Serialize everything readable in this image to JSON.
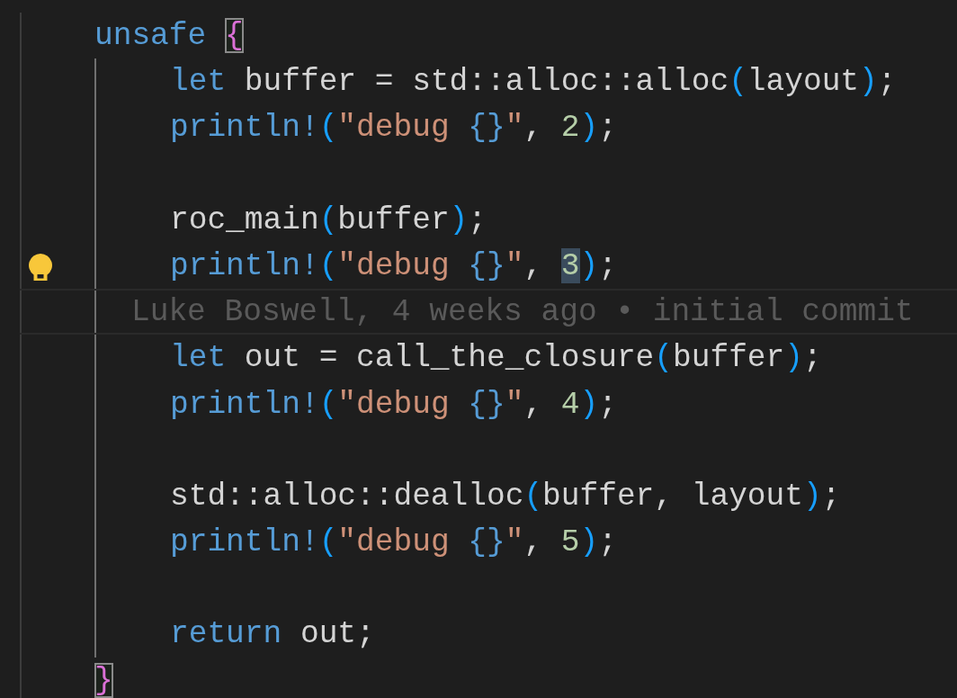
{
  "lines": [
    {
      "kind": "code",
      "tokens": [
        {
          "text": "unsafe ",
          "kind": "keyword"
        },
        {
          "text": "{",
          "kind": "brace",
          "matched": true
        }
      ],
      "children": [
        {
          "kind": "code",
          "tokens": [
            {
              "text": "let ",
              "kind": "keyword"
            },
            {
              "text": "buffer = std::alloc::alloc",
              "kind": "plain"
            },
            {
              "text": "(",
              "kind": "paren"
            },
            {
              "text": "layout",
              "kind": "plain"
            },
            {
              "text": ")",
              "kind": "paren"
            },
            {
              "text": ";",
              "kind": "plain"
            }
          ]
        },
        {
          "kind": "code",
          "tokens": [
            {
              "text": "println!",
              "kind": "macro"
            },
            {
              "text": "(",
              "kind": "paren"
            },
            {
              "text": "\"debug ",
              "kind": "string"
            },
            {
              "text": "{}",
              "kind": "format"
            },
            {
              "text": "\"",
              "kind": "string"
            },
            {
              "text": ", ",
              "kind": "plain"
            },
            {
              "text": "2",
              "kind": "number"
            },
            {
              "text": ")",
              "kind": "paren"
            },
            {
              "text": ";",
              "kind": "plain"
            }
          ]
        },
        {
          "kind": "blank"
        },
        {
          "kind": "code",
          "tokens": [
            {
              "text": "roc_main",
              "kind": "plain"
            },
            {
              "text": "(",
              "kind": "paren"
            },
            {
              "text": "buffer",
              "kind": "plain"
            },
            {
              "text": ")",
              "kind": "paren"
            },
            {
              "text": ";",
              "kind": "plain"
            }
          ]
        },
        {
          "kind": "code",
          "lightbulb": true,
          "tokens": [
            {
              "text": "println!",
              "kind": "macro"
            },
            {
              "text": "(",
              "kind": "paren"
            },
            {
              "text": "\"debug ",
              "kind": "string"
            },
            {
              "text": "{}",
              "kind": "format"
            },
            {
              "text": "\"",
              "kind": "string"
            },
            {
              "text": ", ",
              "kind": "plain"
            },
            {
              "text": "3",
              "kind": "number",
              "selected": true
            },
            {
              "text": ")",
              "kind": "paren"
            },
            {
              "text": ";",
              "kind": "plain"
            }
          ]
        },
        {
          "kind": "blame",
          "text": "Luke Boswell, 4 weeks ago • initial commit"
        },
        {
          "kind": "code",
          "tokens": [
            {
              "text": "let ",
              "kind": "keyword"
            },
            {
              "text": "out = call_the_closure",
              "kind": "plain"
            },
            {
              "text": "(",
              "kind": "paren"
            },
            {
              "text": "buffer",
              "kind": "plain"
            },
            {
              "text": ")",
              "kind": "paren"
            },
            {
              "text": ";",
              "kind": "plain"
            }
          ]
        },
        {
          "kind": "code",
          "tokens": [
            {
              "text": "println!",
              "kind": "macro"
            },
            {
              "text": "(",
              "kind": "paren"
            },
            {
              "text": "\"debug ",
              "kind": "string"
            },
            {
              "text": "{}",
              "kind": "format"
            },
            {
              "text": "\"",
              "kind": "string"
            },
            {
              "text": ", ",
              "kind": "plain"
            },
            {
              "text": "4",
              "kind": "number"
            },
            {
              "text": ")",
              "kind": "paren"
            },
            {
              "text": ";",
              "kind": "plain"
            }
          ]
        },
        {
          "kind": "blank"
        },
        {
          "kind": "code",
          "tokens": [
            {
              "text": "std::alloc::dealloc",
              "kind": "plain"
            },
            {
              "text": "(",
              "kind": "paren"
            },
            {
              "text": "buffer, layout",
              "kind": "plain"
            },
            {
              "text": ")",
              "kind": "paren"
            },
            {
              "text": ";",
              "kind": "plain"
            }
          ]
        },
        {
          "kind": "code",
          "tokens": [
            {
              "text": "println!",
              "kind": "macro"
            },
            {
              "text": "(",
              "kind": "paren"
            },
            {
              "text": "\"debug ",
              "kind": "string"
            },
            {
              "text": "{}",
              "kind": "format"
            },
            {
              "text": "\"",
              "kind": "string"
            },
            {
              "text": ", ",
              "kind": "plain"
            },
            {
              "text": "5",
              "kind": "number"
            },
            {
              "text": ")",
              "kind": "paren"
            },
            {
              "text": ";",
              "kind": "plain"
            }
          ]
        },
        {
          "kind": "blank"
        },
        {
          "kind": "code",
          "tokens": [
            {
              "text": "return ",
              "kind": "keyword"
            },
            {
              "text": "out;",
              "kind": "plain"
            }
          ]
        }
      ]
    },
    {
      "kind": "code",
      "tokens": [
        {
          "text": "}",
          "kind": "brace",
          "matched": true
        }
      ]
    }
  ]
}
